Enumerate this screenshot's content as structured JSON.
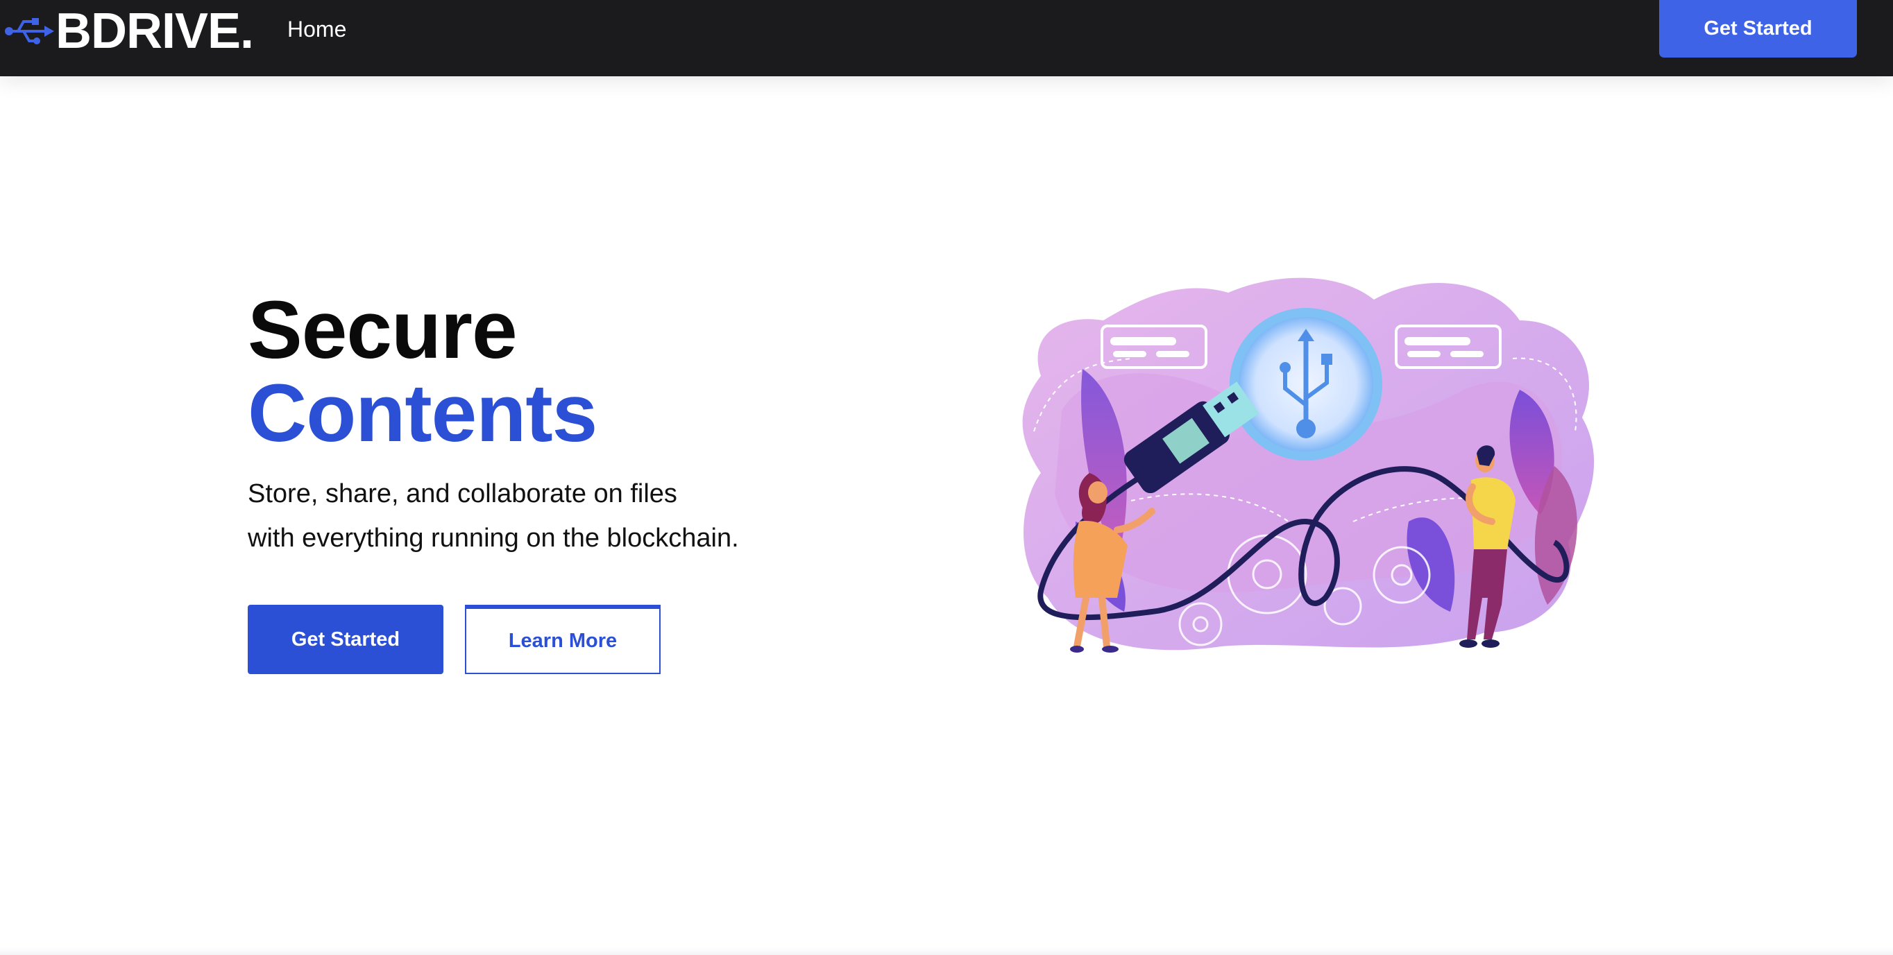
{
  "header": {
    "brand": "BDRIVE.",
    "brand_icon": "usb-icon",
    "nav": {
      "home": "Home"
    },
    "cta": "Get Started"
  },
  "hero": {
    "title_line1": "Secure",
    "title_line2": "Contents",
    "subtitle_line1": "Store, share, and collaborate on files",
    "subtitle_line2": "with everything running on the blockchain.",
    "primary_button": "Get Started",
    "secondary_button": "Learn More"
  },
  "colors": {
    "navbar_bg": "#1b1b1e",
    "accent": "#2b4fd5",
    "nav_cta": "#3f63e6",
    "headline": "#0a0a0a"
  }
}
